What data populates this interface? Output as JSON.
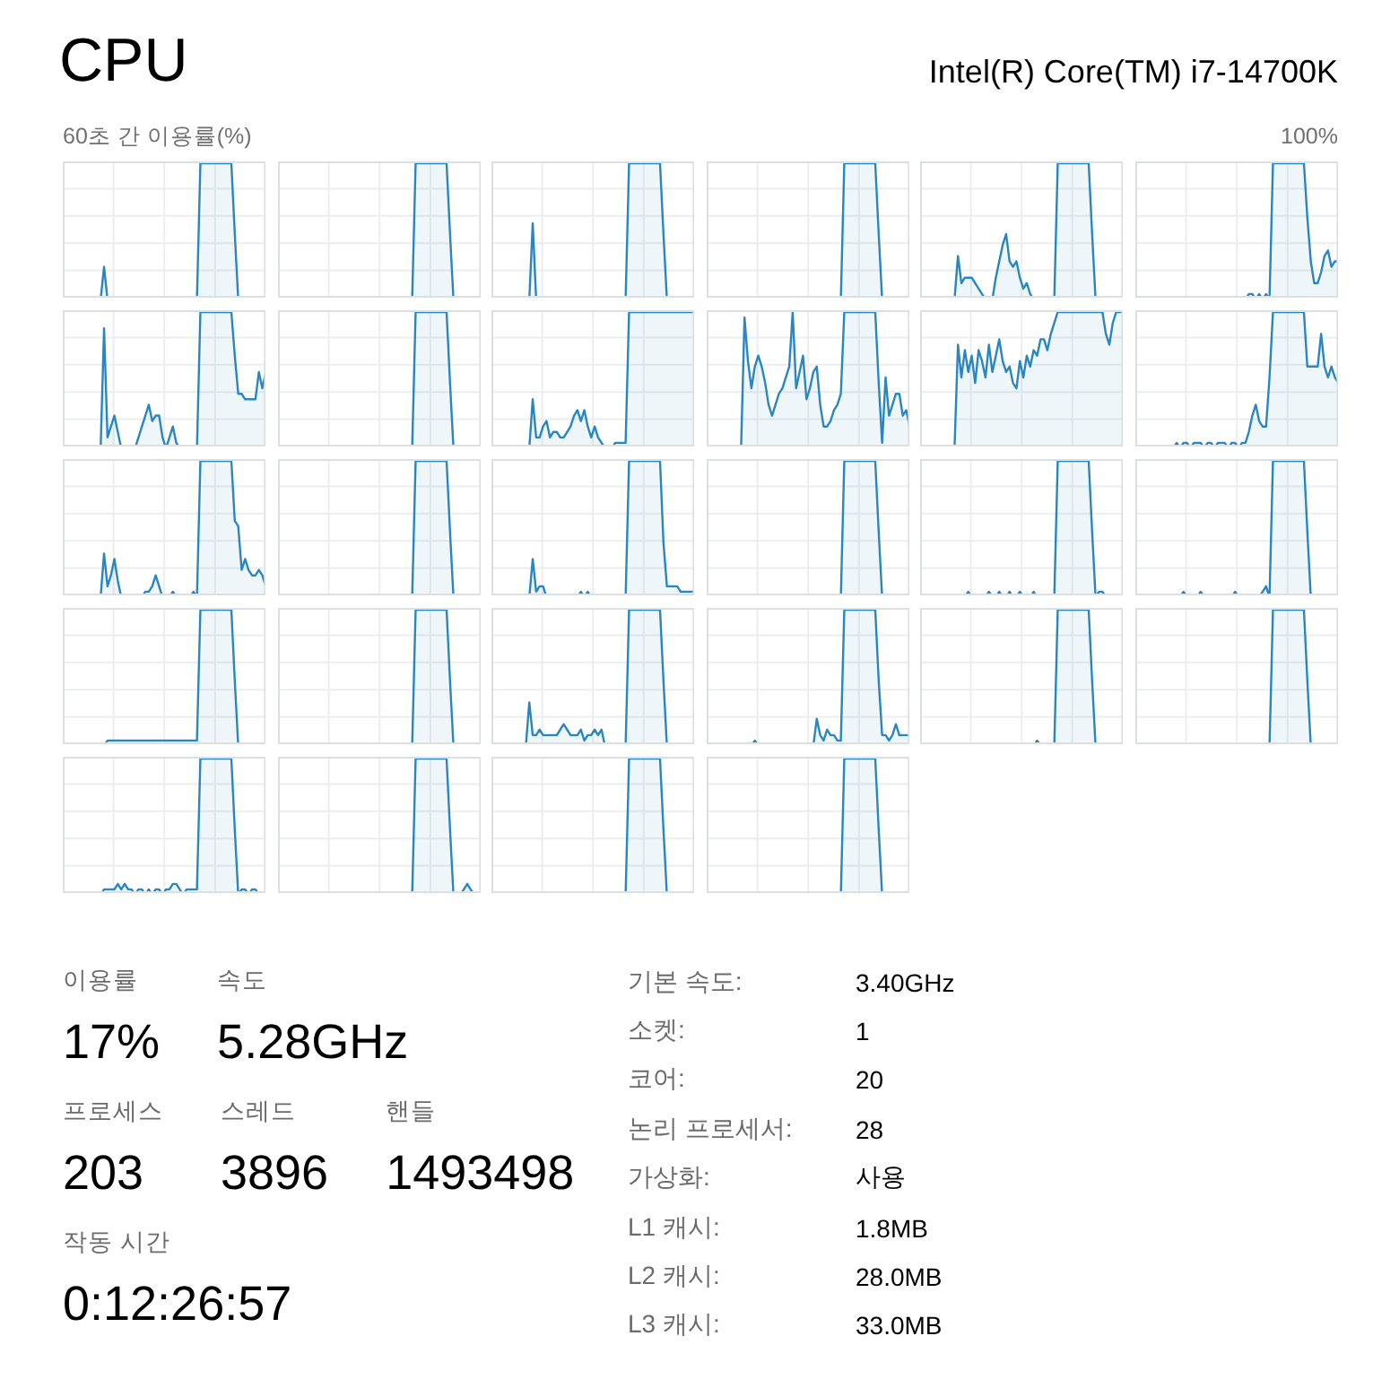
{
  "header": {
    "title": "CPU",
    "processor": "Intel(R) Core(TM) i7-14700K"
  },
  "graph_panel": {
    "caption": "60초 간 이용률(%)",
    "max_label": "100%",
    "graphs": [
      {
        "kind": "line"
      },
      {
        "kind": "line"
      },
      {
        "kind": "line"
      },
      {
        "kind": "line"
      },
      {
        "kind": "line"
      },
      {
        "kind": "line"
      },
      {
        "kind": "line"
      },
      {
        "kind": "line"
      },
      {
        "kind": "line"
      },
      {
        "kind": "line"
      },
      {
        "kind": "line"
      },
      {
        "kind": "line"
      },
      {
        "kind": "line"
      },
      {
        "kind": "line"
      },
      {
        "kind": "line"
      },
      {
        "kind": "line"
      },
      {
        "kind": "line"
      },
      {
        "kind": "line"
      },
      {
        "kind": "line"
      },
      {
        "kind": "line"
      },
      {
        "kind": "line"
      },
      {
        "kind": "line"
      },
      {
        "kind": "line"
      },
      {
        "kind": "line"
      },
      {
        "kind": "line"
      },
      {
        "kind": "line"
      },
      {
        "kind": "line"
      },
      {
        "kind": "line"
      }
    ]
  },
  "live_stats": [
    {
      "items": [
        {
          "label": "이용률",
          "value": "17%"
        },
        {
          "label": "속도",
          "value": "5.28GHz"
        }
      ]
    },
    {
      "items": [
        {
          "label": "프로세스",
          "value": "203"
        },
        {
          "label": "스레드",
          "value": "3896"
        },
        {
          "label": "핸들",
          "value": "1493498"
        }
      ]
    },
    {
      "items": [
        {
          "label": "작동 시간",
          "value": "0:12:26:57"
        }
      ]
    }
  ],
  "details": [
    {
      "label": "기본 속도:",
      "value": "3.40GHz"
    },
    {
      "label": "소켓:",
      "value": "1"
    },
    {
      "label": "코어:",
      "value": "20"
    },
    {
      "label": "논리 프로세서:",
      "value": "28"
    },
    {
      "label": "가상화:",
      "value": "사용"
    },
    {
      "label": "L1 캐시:",
      "value": "1.8MB"
    },
    {
      "label": "L2 캐시:",
      "value": "28.0MB"
    },
    {
      "label": "L3 캐시:",
      "value": "33.0MB"
    }
  ]
}
